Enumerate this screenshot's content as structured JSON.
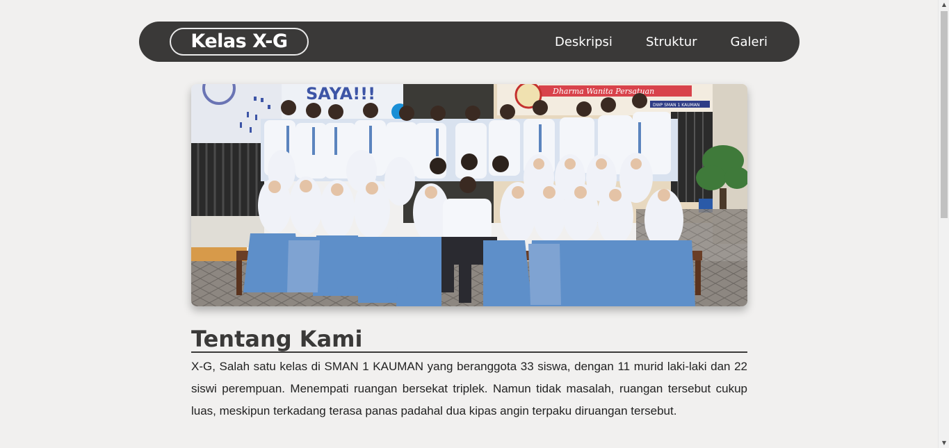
{
  "navbar": {
    "brand": "Kelas X-G",
    "links": [
      "Deskripsi",
      "Struktur",
      "Galeri"
    ]
  },
  "hero": {
    "banner_text": "SAYA!!!",
    "sign_text": "Dharma Wanita Persatuan",
    "sign_small_text": "DWP SMAN 1 KAUMAN"
  },
  "about": {
    "title": "Tentang Kami",
    "text": "X-G, Salah satu kelas di SMAN 1 KAUMAN yang beranggota 33 siswa, dengan 11 murid laki-laki dan 22 siswi perempuan. Menempati ruangan bersekat triplek. Namun tidak masalah, ruangan tersebut cukup luas, meskipun terkadang terasa panas padahal dua kipas angin terpaku diruangan tersebut."
  },
  "colors": {
    "page_bg": "#f1f0ef",
    "navbar_bg": "#3a3938",
    "text_dark": "#3a3938"
  },
  "icons": {
    "scroll_up": "triangle-up-icon",
    "scroll_down": "triangle-down-icon"
  }
}
